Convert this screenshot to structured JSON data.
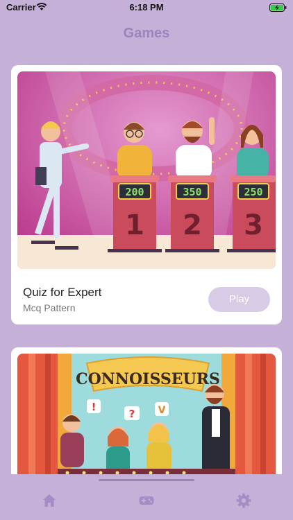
{
  "status_bar": {
    "carrier": "Carrier",
    "time": "6:18 PM",
    "icons": [
      "wifi-icon",
      "battery-charging-icon"
    ]
  },
  "header": {
    "title": "Games"
  },
  "games": [
    {
      "title": "Quiz for Expert",
      "subtitle": "Mcq Pattern",
      "play_label": "Play",
      "illustration": "quiz-show-contestants",
      "scores": [
        "200",
        "350",
        "250"
      ],
      "podium_numbers": [
        "1",
        "2",
        "3"
      ]
    },
    {
      "illustration": "connoisseurs-quiz-show",
      "banner": "CONNOISSEURS",
      "bubbles": [
        "!",
        "?",
        "V"
      ]
    }
  ],
  "tab_bar": {
    "items": [
      "home-icon",
      "gamepad-icon",
      "gear-icon"
    ],
    "active": "gamepad-icon"
  },
  "colors": {
    "background": "#c5b0d7",
    "accent": "#9d83bd",
    "button": "#d8cbe5"
  }
}
